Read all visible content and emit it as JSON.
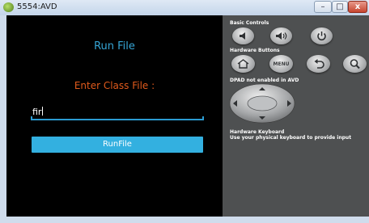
{
  "window": {
    "title": "5554:AVD",
    "min_glyph": "–",
    "max_glyph": "□",
    "close_glyph": "x"
  },
  "app": {
    "title": "Run File",
    "prompt_label": "Enter Class File :",
    "input_value": "fir",
    "run_button_label": "RunFile"
  },
  "panel": {
    "basic_controls_label": "Basic Controls",
    "hardware_buttons_label": "Hardware Buttons",
    "menu_label": "MENU",
    "dpad_label": "DPAD not enabled in AVD",
    "keyboard_title": "Hardware Keyboard",
    "keyboard_hint": "Use your physical keyboard to provide input"
  },
  "colors": {
    "accent": "#33b0e0",
    "label_orange": "#e05a1c",
    "panel_bg": "#4e5051"
  }
}
